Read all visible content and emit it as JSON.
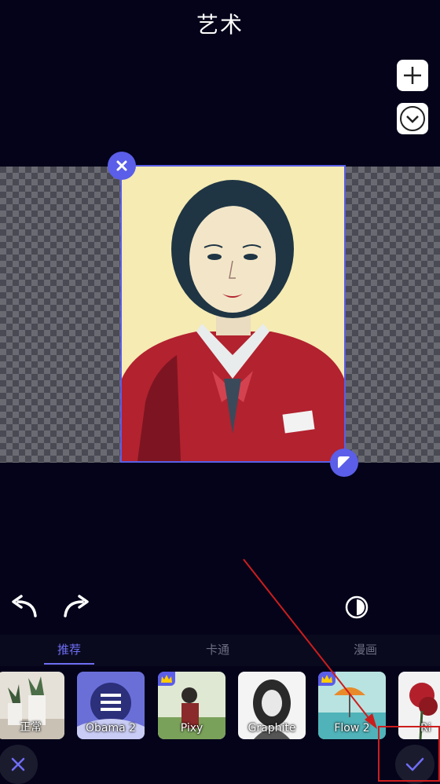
{
  "header": {
    "title": "艺术"
  },
  "side_controls": {
    "add_icon": "plus-icon",
    "collapse_icon": "chevron-down-icon"
  },
  "editor": {
    "delete_icon": "close-icon",
    "resize_icon": "resize-icon"
  },
  "toolbar": {
    "undo_icon": "undo-icon",
    "redo_icon": "redo-icon",
    "compare_icon": "contrast-icon"
  },
  "tabs": [
    {
      "label": "推荐",
      "active": true
    },
    {
      "label": "卡通",
      "active": false
    },
    {
      "label": "漫画",
      "active": false
    }
  ],
  "filters": [
    {
      "label": "正常",
      "premium": false
    },
    {
      "label": "Obama 2",
      "premium": false
    },
    {
      "label": "Pixy",
      "premium": true
    },
    {
      "label": "Graphite",
      "premium": false
    },
    {
      "label": "Flow 2",
      "premium": true
    },
    {
      "label": "Ri",
      "premium": false
    }
  ],
  "bottom": {
    "cancel_icon": "close-icon",
    "confirm_icon": "check-icon"
  },
  "colors": {
    "accent": "#5b5ee8",
    "background": "#04031a",
    "annotation": "#cc1d1d"
  }
}
